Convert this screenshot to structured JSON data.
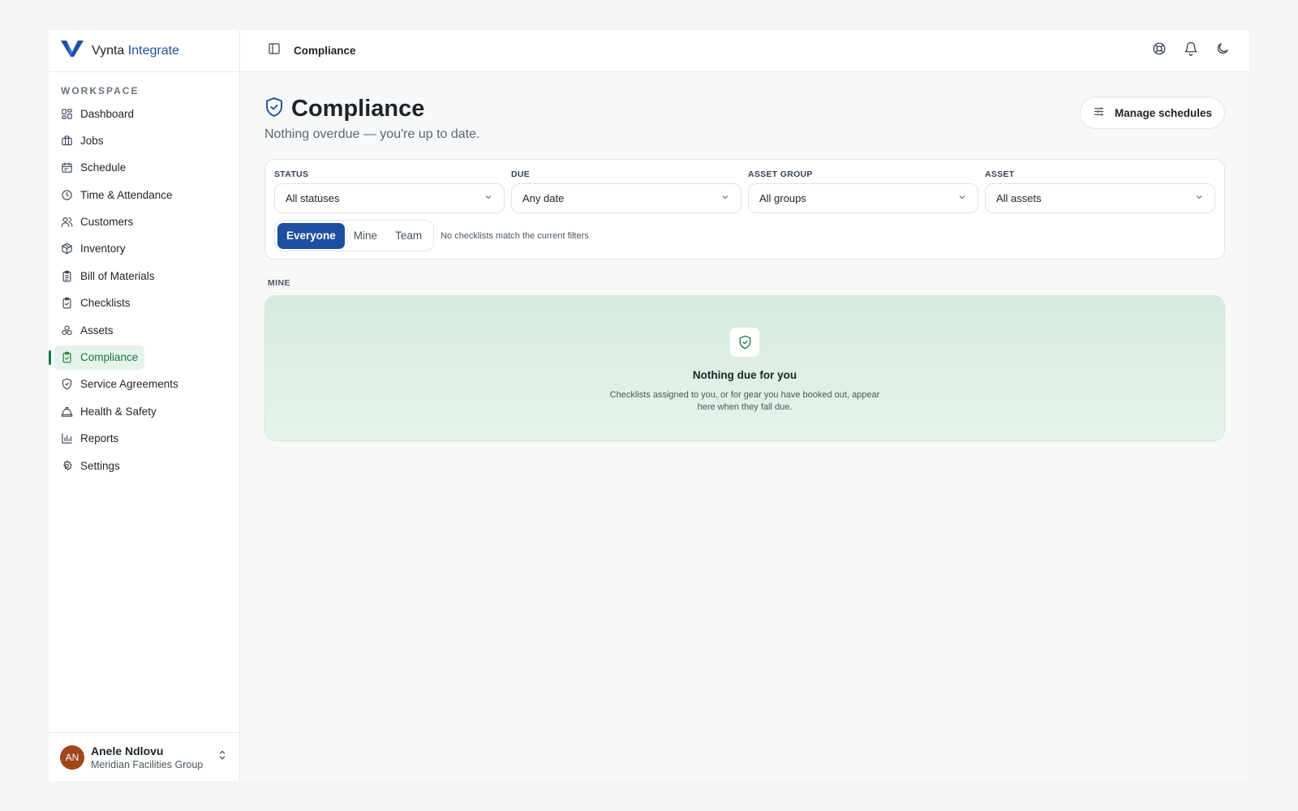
{
  "brand": {
    "name": "Vynta",
    "product": "Integrate"
  },
  "sidebar": {
    "section": "WORKSPACE",
    "items": [
      {
        "label": "Dashboard",
        "icon": "dashboard-icon"
      },
      {
        "label": "Jobs",
        "icon": "briefcase-icon"
      },
      {
        "label": "Schedule",
        "icon": "calendar-icon"
      },
      {
        "label": "Time & Attendance",
        "icon": "clock-icon"
      },
      {
        "label": "Customers",
        "icon": "users-icon"
      },
      {
        "label": "Inventory",
        "icon": "package-icon"
      },
      {
        "label": "Bill of Materials",
        "icon": "clipboard-list-icon"
      },
      {
        "label": "Checklists",
        "icon": "clipboard-check-icon"
      },
      {
        "label": "Assets",
        "icon": "shapes-icon"
      },
      {
        "label": "Compliance",
        "icon": "clipboard-check-icon",
        "active": true
      },
      {
        "label": "Service Agreements",
        "icon": "shield-check-icon"
      },
      {
        "label": "Health & Safety",
        "icon": "hard-hat-icon"
      },
      {
        "label": "Reports",
        "icon": "bar-chart-icon"
      },
      {
        "label": "Settings",
        "icon": "gear-icon"
      }
    ]
  },
  "user": {
    "initials": "AN",
    "name": "Anele Ndlovu",
    "org": "Meridian Facilities Group"
  },
  "topbar": {
    "title": "Compliance"
  },
  "page": {
    "title": "Compliance",
    "subtitle": "Nothing overdue — you're up to date.",
    "manage_label": "Manage schedules"
  },
  "filters": {
    "status": {
      "label": "STATUS",
      "value": "All statuses"
    },
    "due": {
      "label": "DUE",
      "value": "Any date"
    },
    "asset_group": {
      "label": "ASSET GROUP",
      "value": "All groups"
    },
    "asset": {
      "label": "ASSET",
      "value": "All assets"
    },
    "scope": {
      "options": [
        "Everyone",
        "Mine",
        "Team"
      ],
      "selected": "Everyone"
    },
    "hint": "No checklists match the current filters"
  },
  "mine": {
    "label": "MINE",
    "empty_title": "Nothing due for you",
    "empty_desc": "Checklists assigned to you, or for gear you have booked out, appear here when they fall due."
  },
  "colors": {
    "accent": "#1e4fa0",
    "active_green": "#1a7a3f",
    "avatar": "#a0451c"
  }
}
